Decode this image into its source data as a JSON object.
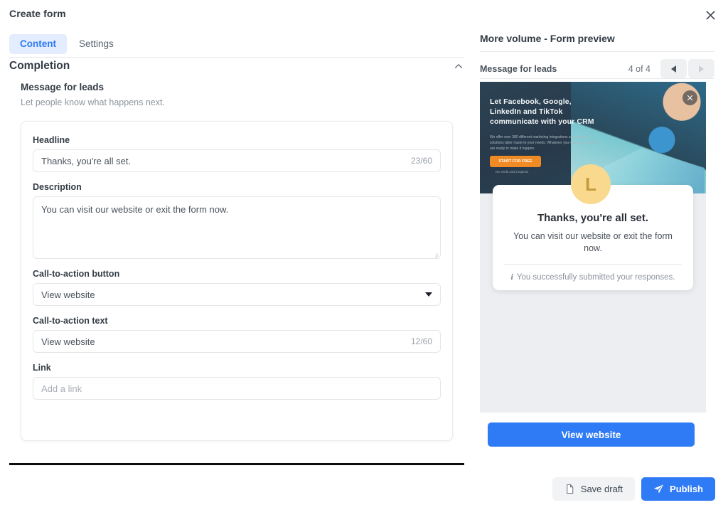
{
  "dialog": {
    "title": "Create form",
    "close_icon": "close-icon"
  },
  "tabs": [
    {
      "label": "Content",
      "active": true
    },
    {
      "label": "Settings",
      "active": false
    }
  ],
  "section": {
    "title": "Completion",
    "collapse_icon": "chevron-up-icon",
    "sub_title": "Message for leads",
    "sub_desc": "Let people know what happens next."
  },
  "fields": {
    "headline": {
      "label": "Headline",
      "value": "Thanks, you're all set.",
      "counter": "23/60"
    },
    "description": {
      "label": "Description",
      "value": "You can visit our website or exit the form now."
    },
    "cta_button": {
      "label": "Call-to-action button",
      "value": "View website",
      "caret_icon": "chevron-down-icon"
    },
    "cta_text": {
      "label": "Call-to-action text",
      "value": "View website",
      "counter": "12/60"
    },
    "link": {
      "label": "Link",
      "placeholder": "Add a link",
      "value": ""
    }
  },
  "preview": {
    "title": "More volume - Form preview",
    "step_label": "Message for leads",
    "step_count": "4 of 4",
    "prev_icon": "triangle-left-icon",
    "next_icon": "triangle-right-icon",
    "banner": {
      "headline": "Let Facebook, Google, LinkedIn and TikTok communicate with your CRM",
      "body": "We offer over 380 different marketing integrations and custom solutions tailor made to your needs. Whatever you need, our experts are ready to make it happen.",
      "cta": "START FOR FREE",
      "note": "No credit card required",
      "close_icon": "close-circle-icon"
    },
    "avatar_letter": "L",
    "card": {
      "headline": "Thanks, you're all set.",
      "description": "You can visit our website or exit the form now.",
      "footer_icon": "info-icon",
      "footer_text": "You successfully submitted your responses."
    },
    "cta_button_label": "View website"
  },
  "footer": {
    "save_draft_label": "Save draft",
    "save_draft_icon": "document-icon",
    "publish_label": "Publish",
    "publish_icon": "paper-plane-icon"
  },
  "colors": {
    "accent_blue": "#2f7af5",
    "tab_active_bg": "#e4edfd",
    "preview_bg": "#eceef1",
    "avatar_bg": "#f9d98d",
    "banner_cta": "#f08a24",
    "rule_black": "#0c0c0c"
  }
}
